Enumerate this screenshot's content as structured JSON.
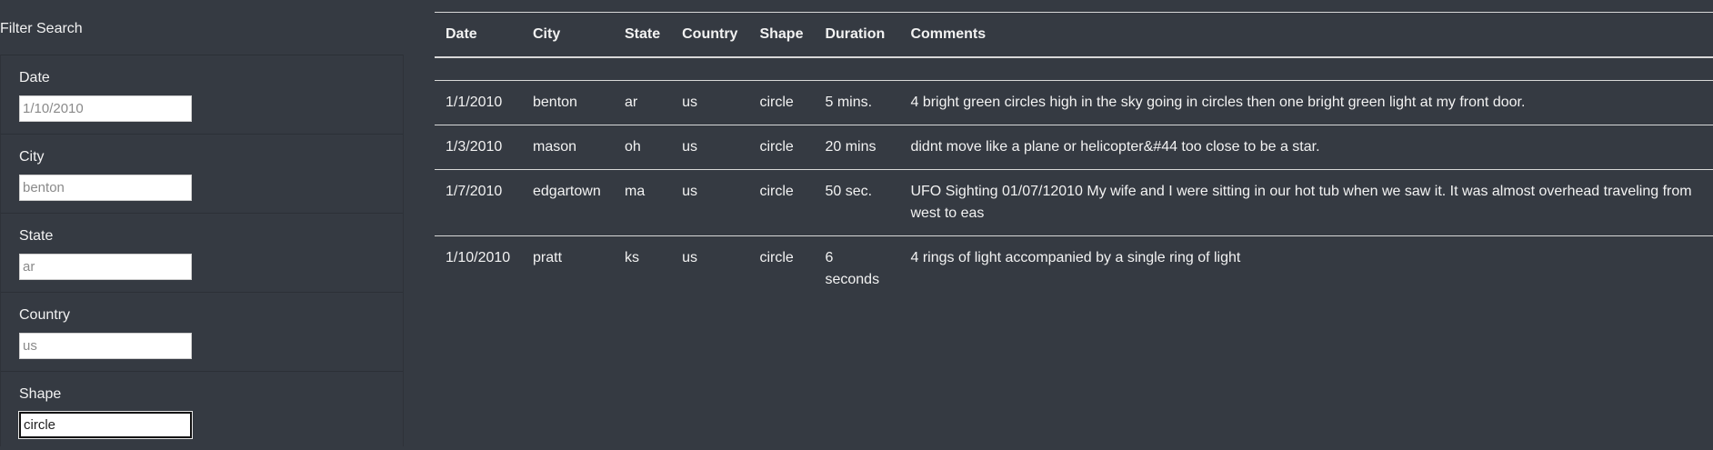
{
  "sidebar": {
    "title": "Filter Search",
    "filters": [
      {
        "label": "Date",
        "value": "",
        "placeholder": "1/10/2010"
      },
      {
        "label": "City",
        "value": "",
        "placeholder": "benton"
      },
      {
        "label": "State",
        "value": "",
        "placeholder": "ar"
      },
      {
        "label": "Country",
        "value": "",
        "placeholder": "us"
      },
      {
        "label": "Shape",
        "value": "circle",
        "placeholder": ""
      }
    ]
  },
  "table": {
    "headers": [
      "Date",
      "City",
      "State",
      "Country",
      "Shape",
      "Duration",
      "Comments"
    ],
    "rows": [
      [
        "1/1/2010",
        "benton",
        "ar",
        "us",
        "circle",
        "5 mins.",
        "4 bright green circles high in the sky going in circles then one bright green light at my front door."
      ],
      [
        "1/3/2010",
        "mason",
        "oh",
        "us",
        "circle",
        "20 mins",
        "didnt move like a plane or helicopter&#44 too close to be a star."
      ],
      [
        "1/7/2010",
        "edgartown",
        "ma",
        "us",
        "circle",
        "50 sec.",
        "UFO Sighting 01/07/12010 My wife and I were sitting in our hot tub when we saw it. It was almost overhead traveling from west to eas"
      ],
      [
        "1/10/2010",
        "pratt",
        "ks",
        "us",
        "circle",
        "6 seconds",
        "4 rings of light accompanied by a single ring of light"
      ]
    ]
  }
}
